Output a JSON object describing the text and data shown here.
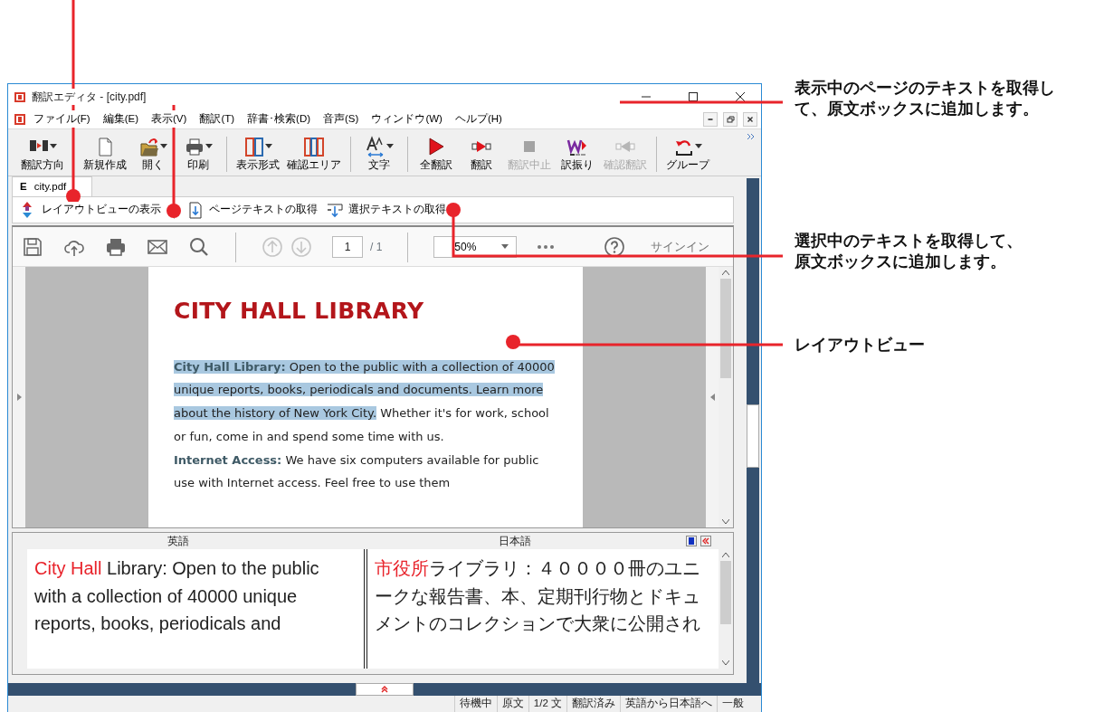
{
  "window": {
    "title": "翻訳エディタ - [city.pdf]"
  },
  "menu": [
    "ファイル(F)",
    "編集(E)",
    "表示(V)",
    "翻訳(T)",
    "辞書･検索(D)",
    "音声(S)",
    "ウィンドウ(W)",
    "ヘルプ(H)"
  ],
  "toolbar": [
    {
      "kind": "button",
      "label": "翻訳方向",
      "dropdown": true,
      "disabled": false
    },
    {
      "kind": "separator"
    },
    {
      "kind": "button",
      "label": "新規作成",
      "dropdown": false,
      "disabled": false
    },
    {
      "kind": "button",
      "label": "開く",
      "dropdown": true,
      "disabled": false
    },
    {
      "kind": "button",
      "label": "印刷",
      "dropdown": true,
      "disabled": false
    },
    {
      "kind": "separator"
    },
    {
      "kind": "button",
      "label": "表示形式",
      "dropdown": true,
      "disabled": false
    },
    {
      "kind": "button",
      "label": "確認エリア",
      "dropdown": false,
      "disabled": false
    },
    {
      "kind": "separator"
    },
    {
      "kind": "button",
      "label": "文字",
      "dropdown": true,
      "disabled": false
    },
    {
      "kind": "separator"
    },
    {
      "kind": "button",
      "label": "全翻訳",
      "dropdown": false,
      "disabled": false
    },
    {
      "kind": "button",
      "label": "翻訳",
      "dropdown": false,
      "disabled": false
    },
    {
      "kind": "button",
      "label": "翻訳中止",
      "dropdown": false,
      "disabled": true
    },
    {
      "kind": "button",
      "label": "訳振り",
      "dropdown": false,
      "disabled": false
    },
    {
      "kind": "button",
      "label": "確認翻訳",
      "dropdown": false,
      "disabled": true
    },
    {
      "kind": "separator"
    },
    {
      "kind": "button",
      "label": "グループ",
      "dropdown": true,
      "disabled": false
    }
  ],
  "doc_tab": {
    "badge": "E",
    "label": "city.pdf",
    "selected": true
  },
  "sub_toolbar": [
    "レイアウトビューの表示",
    "ページテキストの取得",
    "選択テキストの取得"
  ],
  "pdf_toolbar": {
    "page": "1",
    "page_total": "/ 1",
    "zoom": "50%",
    "sign_in": "サインイン"
  },
  "pdf_page": {
    "title": "CITY HALL LIBRARY",
    "paragraphs": [
      [
        {
          "text": "City Hall Library:",
          "bold": true,
          "highlighted": true
        },
        {
          "text": " Open to the public with a collection of 40000 unique reports, books, periodicals and documents. Learn more about the history of New York City.",
          "bold": false,
          "highlighted": true
        },
        {
          "text": " Whether it's for work, school or fun, come in and spend some time with us.",
          "bold": false,
          "highlighted": false
        }
      ],
      [
        {
          "text": "Internet Access:",
          "bold": true,
          "highlighted": false
        },
        {
          "text": " We have six computers available for public use with Internet access. Feel free to use them",
          "bold": false,
          "highlighted": false
        }
      ]
    ]
  },
  "translation": {
    "source_header": "英語",
    "target_header": "日本語",
    "source": [
      {
        "text": "City Hall",
        "term": true
      },
      {
        "text": " Library: Open to the public with a collection of 40000 unique reports, books, periodicals and",
        "term": false
      }
    ],
    "target": [
      {
        "text": "市役所",
        "term": true
      },
      {
        "text": "ライブラリ：４００００冊のユニークな報告書、本、定期刊行物とドキュメントのコレクションで大衆に公開され",
        "term": false
      }
    ]
  },
  "status_bar": [
    "待機中",
    "原文",
    "1/2 文",
    "翻訳済み",
    "英語から日本語へ",
    "一般"
  ],
  "callouts": [
    "表示中のページのテキストを取得して、原文ボックスに追加します。",
    "選択中のテキストを取得して、原文ボックスに追加します。",
    "レイアウトビュー"
  ]
}
